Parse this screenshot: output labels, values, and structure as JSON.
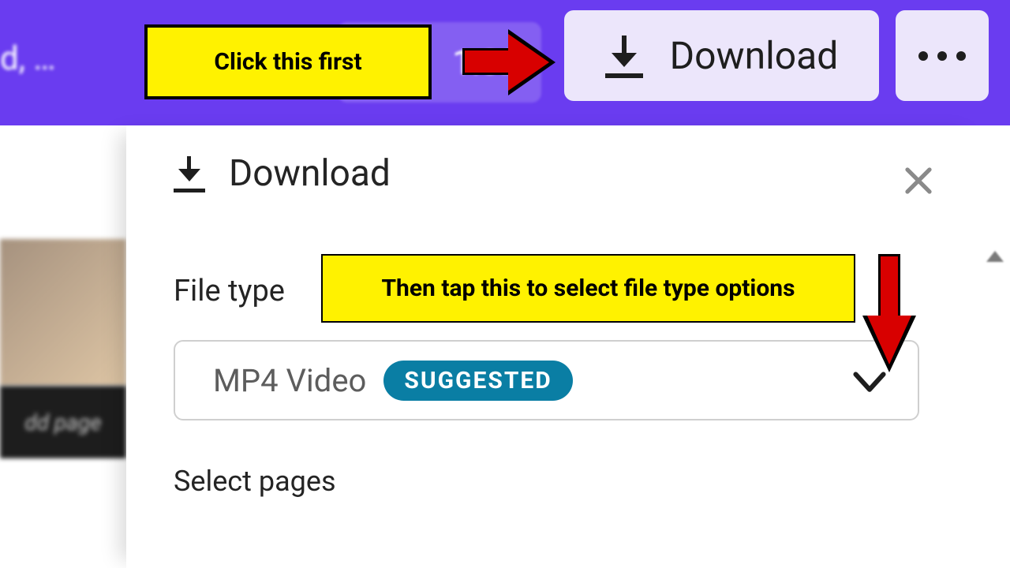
{
  "topbar": {
    "truncated_text": "d, …",
    "time": "1:02",
    "download_label": "Download",
    "more_label": "…"
  },
  "panel": {
    "title": "Download",
    "file_type_label": "File type",
    "file_type_value": "MP4 Video",
    "suggested_badge": "SUGGESTED",
    "select_pages_label": "Select pages"
  },
  "annotations": {
    "first": "Click this first",
    "second": "Then tap this to select file type options"
  },
  "left_strip": {
    "add_page": "dd page"
  }
}
